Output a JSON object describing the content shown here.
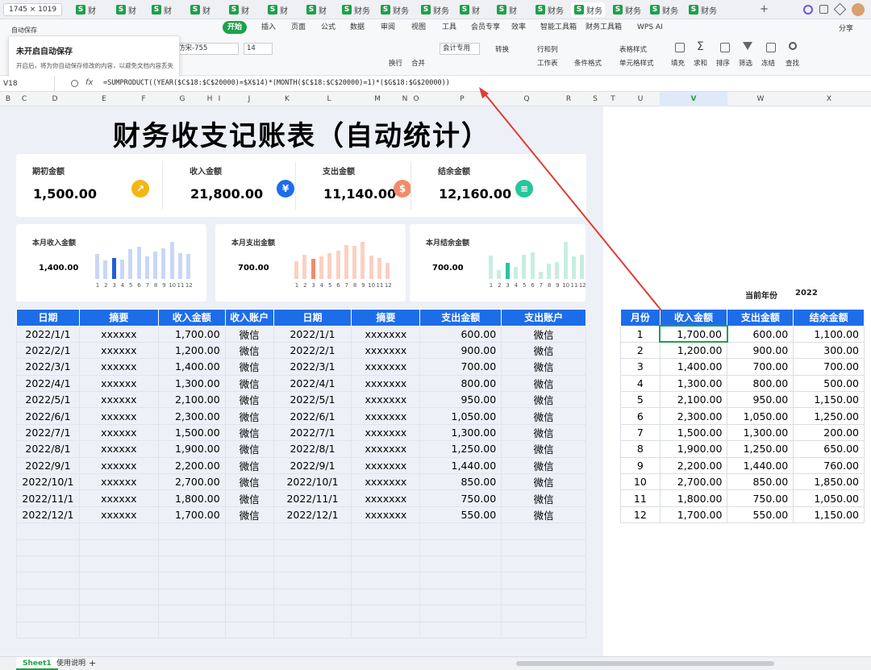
{
  "window": {
    "size_label": "1745 × 1019",
    "tabs": [
      "财",
      "财",
      "财",
      "财",
      "财",
      "财",
      "财",
      "财务",
      "财务",
      "财务",
      "财",
      "财",
      "财务",
      "财务",
      "财务",
      "财务",
      "财务"
    ]
  },
  "ribbon": {
    "tabs": [
      "开始",
      "插入",
      "页面",
      "公式",
      "数据",
      "审阅",
      "视图",
      "工具",
      "会员专享",
      "效率",
      "智能工具箱",
      "财务工具箱",
      "WPS AI"
    ],
    "active": "开始",
    "share": "分享"
  },
  "toolbar": {
    "autosave": "自动保存",
    "font_name": "仿宋-755",
    "font_size": "14",
    "number_format": "会计专用",
    "convert": "转换",
    "rows_cols": "行和列",
    "worksheet": "工作表",
    "cond_format": "条件格式",
    "table_style": "表格样式",
    "cell_style": "单元格样式",
    "fill": "填充",
    "sum": "求和",
    "sort": "排序",
    "filter": "筛选",
    "freeze": "冻结",
    "find": "查找",
    "wrap": "换行",
    "merge": "合并"
  },
  "popup": {
    "title": "未开启自动保存",
    "body": "开启后，将为你自动保存修改的内容，以避免文档内容丢失"
  },
  "formula": {
    "cell": "V18",
    "fx": "fx",
    "text": "=SUMPRODUCT((YEAR($C$18:$C$20000)=$X$14)*(MONTH($C$18:$C$20000)=1)*($G$18:$G$20000))"
  },
  "columns": [
    "B",
    "C",
    "D",
    "E",
    "F",
    "G",
    "H",
    "I",
    "J",
    "K",
    "L",
    "M",
    "N",
    "O",
    "P",
    "Q",
    "R",
    "S",
    "T",
    "U",
    "V",
    "W",
    "X"
  ],
  "title": "财务收支记账表（自动统计）",
  "kpis": [
    {
      "label": "期初金额",
      "value": "1,500.00",
      "icon": "chart-icon",
      "color": "#f3b712"
    },
    {
      "label": "收入金额",
      "value": "21,800.00",
      "icon": "yen-icon",
      "color": "#1e6de8"
    },
    {
      "label": "支出金额",
      "value": "11,140.00",
      "icon": "money-bag-icon",
      "color": "#f28b6a"
    },
    {
      "label": "结余金额",
      "value": "12,160.00",
      "icon": "clipboard-icon",
      "color": "#26c79a"
    }
  ],
  "mini": [
    {
      "label": "本月收入金额",
      "value": "1,400.00",
      "color": "#c9d7f6",
      "highlight": "#1e5fd8",
      "hi_index": 3,
      "values": [
        1700,
        1200,
        1400,
        1300,
        2100,
        2300,
        1500,
        1900,
        2200,
        2700,
        1800,
        1700
      ]
    },
    {
      "label": "本月支出金额",
      "value": "700.00",
      "color": "#fbd0c2",
      "highlight": "#f28b6a",
      "hi_index": 3,
      "values": [
        600,
        900,
        700,
        800,
        950,
        1050,
        1300,
        1250,
        1440,
        850,
        750,
        550
      ]
    },
    {
      "label": "本月结余金额",
      "value": "700.00",
      "color": "#c8eee0",
      "highlight": "#26c79a",
      "hi_index": 3,
      "values": [
        1100,
        300,
        700,
        500,
        1150,
        1250,
        200,
        650,
        760,
        1850,
        1050,
        1150
      ]
    }
  ],
  "mini_ticks": [
    "1",
    "2",
    "3",
    "4",
    "5",
    "6",
    "7",
    "8",
    "9",
    "10",
    "11",
    "12"
  ],
  "ledger": {
    "headers": [
      "日期",
      "摘要",
      "收入金额",
      "收入账户",
      "日期",
      "摘要",
      "支出金额",
      "支出账户"
    ],
    "rows": [
      [
        "2022/1/1",
        "xxxxxx",
        "1,700.00",
        "微信",
        "2022/1/1",
        "xxxxxxx",
        "600.00",
        "微信"
      ],
      [
        "2022/2/1",
        "xxxxxx",
        "1,200.00",
        "微信",
        "2022/2/1",
        "xxxxxxx",
        "900.00",
        "微信"
      ],
      [
        "2022/3/1",
        "xxxxxx",
        "1,400.00",
        "微信",
        "2022/3/1",
        "xxxxxxx",
        "700.00",
        "微信"
      ],
      [
        "2022/4/1",
        "xxxxxx",
        "1,300.00",
        "微信",
        "2022/4/1",
        "xxxxxxx",
        "800.00",
        "微信"
      ],
      [
        "2022/5/1",
        "xxxxxx",
        "2,100.00",
        "微信",
        "2022/5/1",
        "xxxxxxx",
        "950.00",
        "微信"
      ],
      [
        "2022/6/1",
        "xxxxxx",
        "2,300.00",
        "微信",
        "2022/6/1",
        "xxxxxxx",
        "1,050.00",
        "微信"
      ],
      [
        "2022/7/1",
        "xxxxxx",
        "1,500.00",
        "微信",
        "2022/7/1",
        "xxxxxxx",
        "1,300.00",
        "微信"
      ],
      [
        "2022/8/1",
        "xxxxxx",
        "1,900.00",
        "微信",
        "2022/8/1",
        "xxxxxxx",
        "1,250.00",
        "微信"
      ],
      [
        "2022/9/1",
        "xxxxxx",
        "2,200.00",
        "微信",
        "2022/9/1",
        "xxxxxxx",
        "1,440.00",
        "微信"
      ],
      [
        "2022/10/1",
        "xxxxxx",
        "2,700.00",
        "微信",
        "2022/10/1",
        "xxxxxxx",
        "850.00",
        "微信"
      ],
      [
        "2022/11/1",
        "xxxxxx",
        "1,800.00",
        "微信",
        "2022/11/1",
        "xxxxxxx",
        "750.00",
        "微信"
      ],
      [
        "2022/12/1",
        "xxxxxx",
        "1,700.00",
        "微信",
        "2022/12/1",
        "xxxxxxx",
        "550.00",
        "微信"
      ]
    ]
  },
  "current_year": {
    "label": "当前年份",
    "value": "2022"
  },
  "monthly": {
    "headers": [
      "月份",
      "收入金额",
      "支出金额",
      "结余金额"
    ],
    "rows": [
      [
        "1",
        "1,700.00",
        "600.00",
        "1,100.00"
      ],
      [
        "2",
        "1,200.00",
        "900.00",
        "300.00"
      ],
      [
        "3",
        "1,400.00",
        "700.00",
        "700.00"
      ],
      [
        "4",
        "1,300.00",
        "800.00",
        "500.00"
      ],
      [
        "5",
        "2,100.00",
        "950.00",
        "1,150.00"
      ],
      [
        "6",
        "2,300.00",
        "1,050.00",
        "1,250.00"
      ],
      [
        "7",
        "1,500.00",
        "1,300.00",
        "200.00"
      ],
      [
        "8",
        "1,900.00",
        "1,250.00",
        "650.00"
      ],
      [
        "9",
        "2,200.00",
        "1,440.00",
        "760.00"
      ],
      [
        "10",
        "2,700.00",
        "850.00",
        "1,850.00"
      ],
      [
        "11",
        "1,800.00",
        "750.00",
        "1,050.00"
      ],
      [
        "12",
        "1,700.00",
        "550.00",
        "1,150.00"
      ]
    ]
  },
  "sheets": [
    "Sheet1",
    "使用说明"
  ]
}
